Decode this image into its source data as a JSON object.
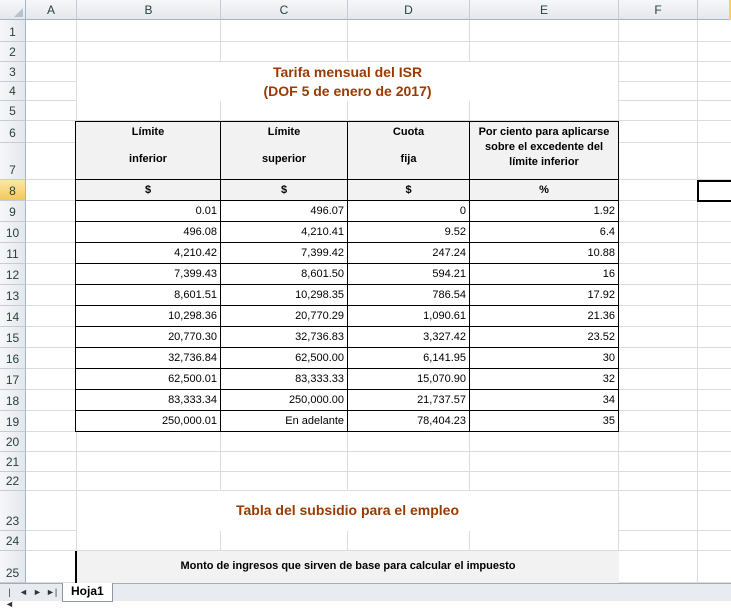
{
  "columns": [
    "A",
    "B",
    "C",
    "D",
    "E",
    "F"
  ],
  "rows": [
    "1",
    "2",
    "3",
    "4",
    "5",
    "6",
    "7",
    "8",
    "9",
    "10",
    "11",
    "12",
    "13",
    "14",
    "15",
    "16",
    "17",
    "18",
    "19",
    "20",
    "21",
    "22",
    "23",
    "24",
    "25"
  ],
  "titles": {
    "isr_line1": "Tarifa mensual del ISR",
    "isr_line2": "(DOF 5 de enero de 2017)",
    "subsidio": "Tabla del subsidio para el empleo"
  },
  "table": {
    "headers": {
      "col1_line1": "Límite",
      "col1_line2": "inferior",
      "col2_line1": "Límite",
      "col2_line2": "superior",
      "col3_line1": "Cuota",
      "col3_line2": "fija",
      "col4": "Por ciento para aplicarse sobre el excedente del límite inferior"
    },
    "units": [
      "$",
      "$",
      "$",
      "%"
    ],
    "rows": [
      [
        "0.01",
        "496.07",
        "0",
        "1.92"
      ],
      [
        "496.08",
        "4,210.41",
        "9.52",
        "6.4"
      ],
      [
        "4,210.42",
        "7,399.42",
        "247.24",
        "10.88"
      ],
      [
        "7,399.43",
        "8,601.50",
        "594.21",
        "16"
      ],
      [
        "8,601.51",
        "10,298.35",
        "786.54",
        "17.92"
      ],
      [
        "10,298.36",
        "20,770.29",
        "1,090.61",
        "21.36"
      ],
      [
        "20,770.30",
        "32,736.83",
        "3,327.42",
        "23.52"
      ],
      [
        "32,736.84",
        "62,500.00",
        "6,141.95",
        "30"
      ],
      [
        "62,500.01",
        "83,333.33",
        "15,070.90",
        "32"
      ],
      [
        "83,333.34",
        "250,000.00",
        "21,737.57",
        "34"
      ],
      [
        "250,000.01",
        "En adelante",
        "78,404.23",
        "35"
      ]
    ]
  },
  "subsidio_header": "Monto de ingresos que sirven de base para calcular el impuesto",
  "sheet_tab": "Hoja1",
  "nav_buttons": [
    "|◄",
    "◄",
    "►",
    "►|"
  ]
}
